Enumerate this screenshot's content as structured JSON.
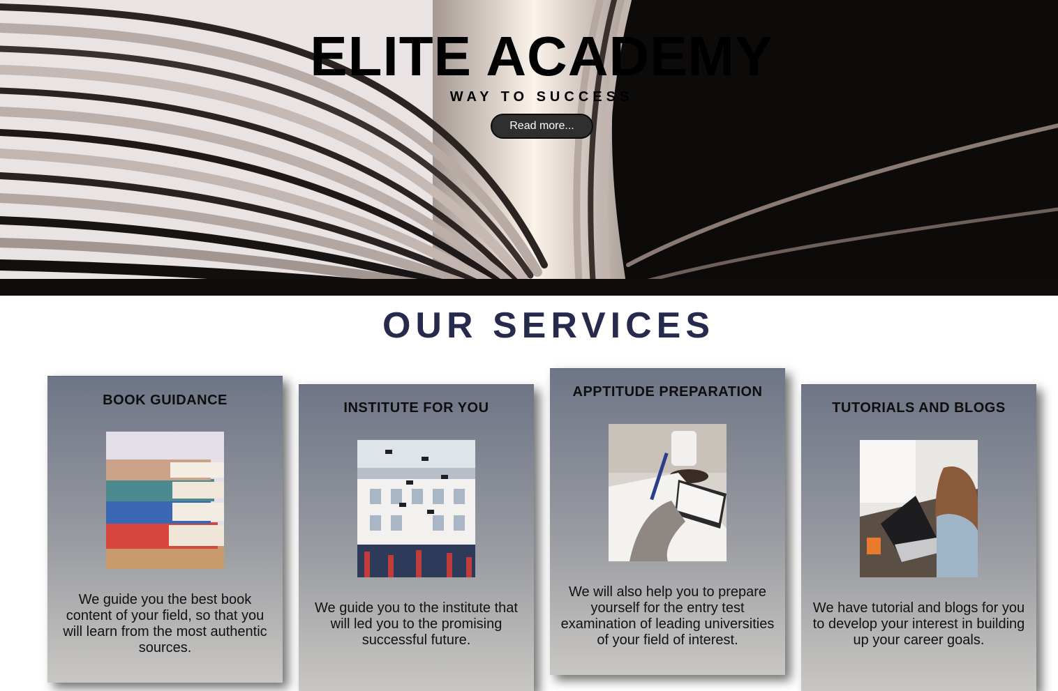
{
  "hero": {
    "title": "ELITE ACADEMY",
    "subtitle": "WAY TO SUCCESS",
    "button_label": "Read more..."
  },
  "services": {
    "heading": "OUR SERVICES",
    "cards": [
      {
        "title": "BOOK GUIDANCE",
        "text": "We guide you the best book content of your field, so that you will learn from the most authentic sources."
      },
      {
        "title": "INSTITUTE FOR YOU",
        "text": "We guide you to the institute that will led you to the promising successful future."
      },
      {
        "title": "APPTITUDE PREPARATION",
        "text": "We will also help you to prepare yourself for the entry test examination of leading universities of your field of interest."
      },
      {
        "title": "TUTORIALS AND BLOGS",
        "text": "We have tutorial and blogs for you to develop your interest in building up your career goals."
      }
    ]
  },
  "colors": {
    "heading": "#262b4e",
    "button_bg": "#2f2f2f",
    "card_top": "#6e7586",
    "card_bottom": "#c9c7c3"
  }
}
